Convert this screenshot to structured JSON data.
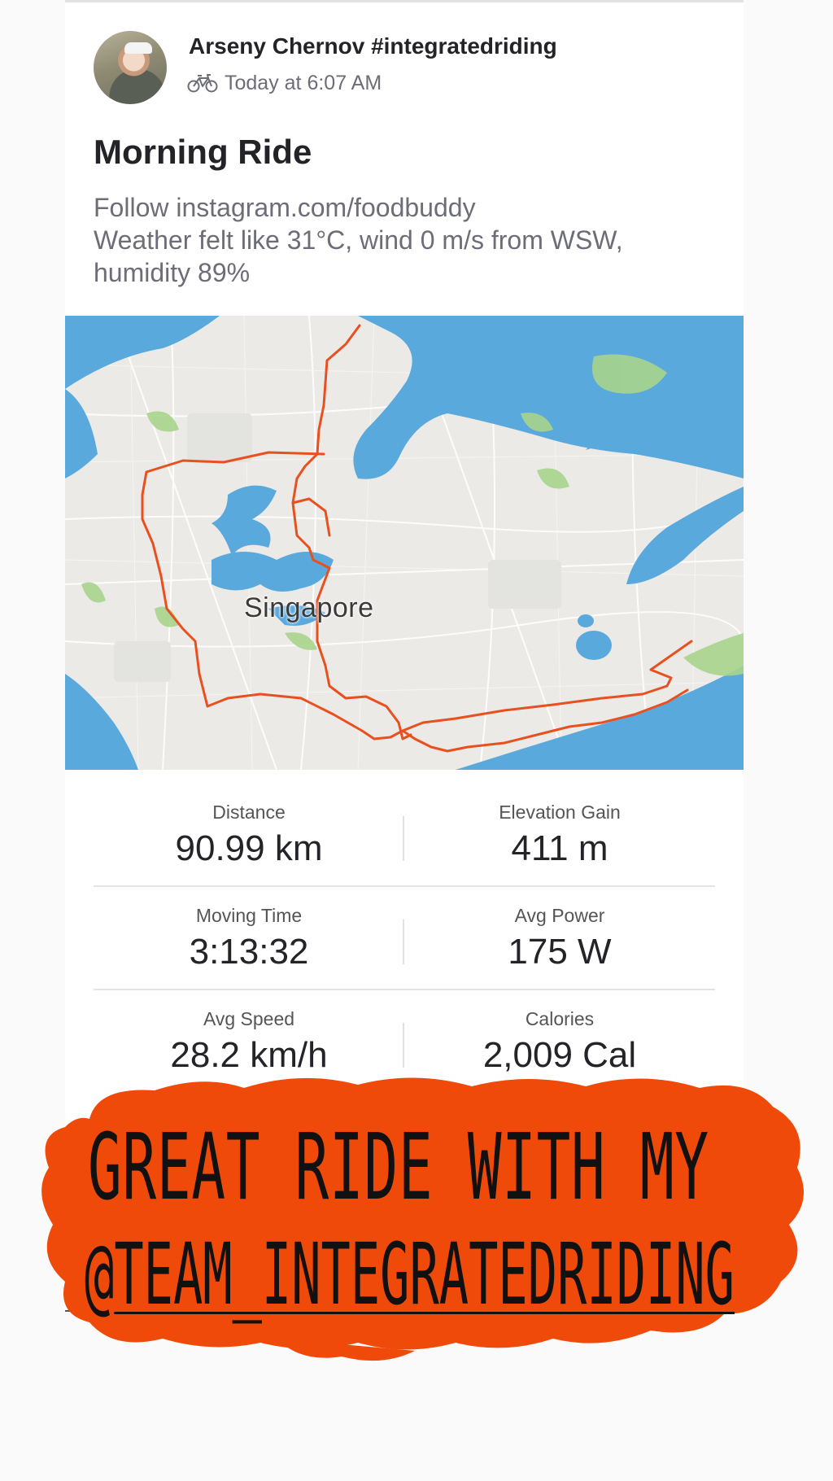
{
  "post": {
    "user_name": "Arseny Chernov #integratedriding",
    "activity_icon": "bike-icon",
    "timestamp": "Today at 6:07 AM",
    "title": "Morning Ride",
    "description_lines": [
      "Follow instagram.com/foodbuddy",
      "Weather felt like 31°C, wind 0 m/s from WSW,",
      "humidity 89%"
    ]
  },
  "map": {
    "label": "Singapore",
    "route_color": "#e8501f",
    "water_color": "#5aa9dd",
    "park_color": "#a8d48c"
  },
  "stats": [
    {
      "left": {
        "label": "Distance",
        "value": "90.99 km"
      },
      "right": {
        "label": "Elevation Gain",
        "value": "411 m"
      }
    },
    {
      "left": {
        "label": "Moving Time",
        "value": "3:13:32"
      },
      "right": {
        "label": "Avg Power",
        "value": "175 W"
      }
    },
    {
      "left": {
        "label": "Avg Speed",
        "value": "28.2 km/h"
      },
      "right": {
        "label": "Calories",
        "value": "2,009 Cal"
      }
    }
  ],
  "sticker": {
    "line1": "GREAT RIDE WITH MY",
    "at": "@",
    "handle": "TEAM_INTEGRATEDRIDING",
    "color": "#f04a0a"
  }
}
